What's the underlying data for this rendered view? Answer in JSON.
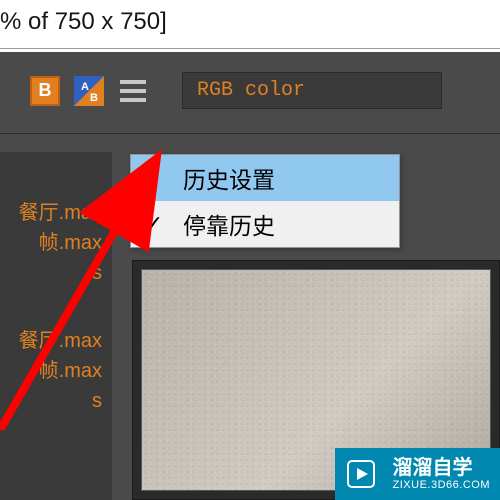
{
  "title_fragment": "% of 750 x 750]",
  "toolbar": {
    "b_icon_label": "B",
    "rgb_label": "RGB color"
  },
  "menu": {
    "items": [
      {
        "label": "历史设置",
        "checked": false,
        "highlight": true
      },
      {
        "label": "停靠历史",
        "checked": true,
        "highlight": false
      }
    ]
  },
  "sidebar": {
    "groups": [
      [
        "餐厅.max",
        "帧.max",
        "s"
      ],
      [
        "餐厅.max",
        "帧.max",
        "s"
      ]
    ]
  },
  "watermark": {
    "cn": "溜溜自学",
    "url": "ZIXUE.3D66.COM"
  }
}
